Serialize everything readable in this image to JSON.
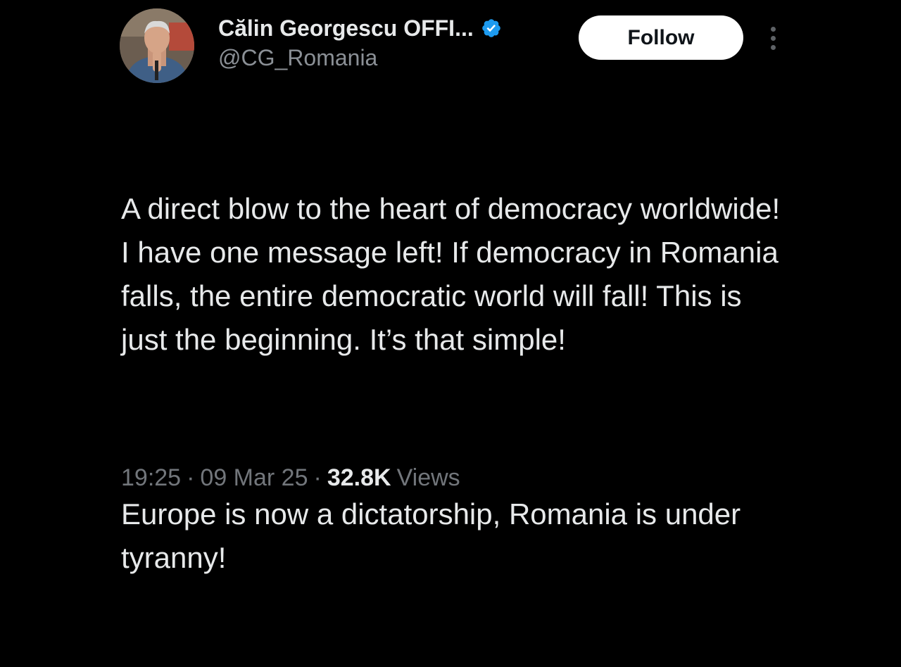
{
  "author": {
    "display_name": "Călin Georgescu OFFI...",
    "handle": "@CG_Romania",
    "avatar_icon": "profile-photo",
    "verified_icon": "verified-badge-icon",
    "verified_color": "#1d9bf0"
  },
  "actions": {
    "follow_label": "Follow",
    "more_icon": "more-vertical-icon"
  },
  "tweet": {
    "paragraphs": [
      "A direct blow to the heart of democracy worldwide! I have one message left! If democracy in Romania falls, the entire democratic world will fall! This is just the beginning. It’s that simple!",
      "Europe is now a dictatorship, Romania is under tyranny!"
    ]
  },
  "meta": {
    "time": "19:25",
    "separator": "·",
    "date": "09 Mar 25",
    "views_count": "32.8K",
    "views_label": "Views"
  },
  "colors": {
    "background": "#000000",
    "text": "#e7e9ea",
    "secondary_text": "#8b9096",
    "follow_bg": "#ffffff"
  }
}
